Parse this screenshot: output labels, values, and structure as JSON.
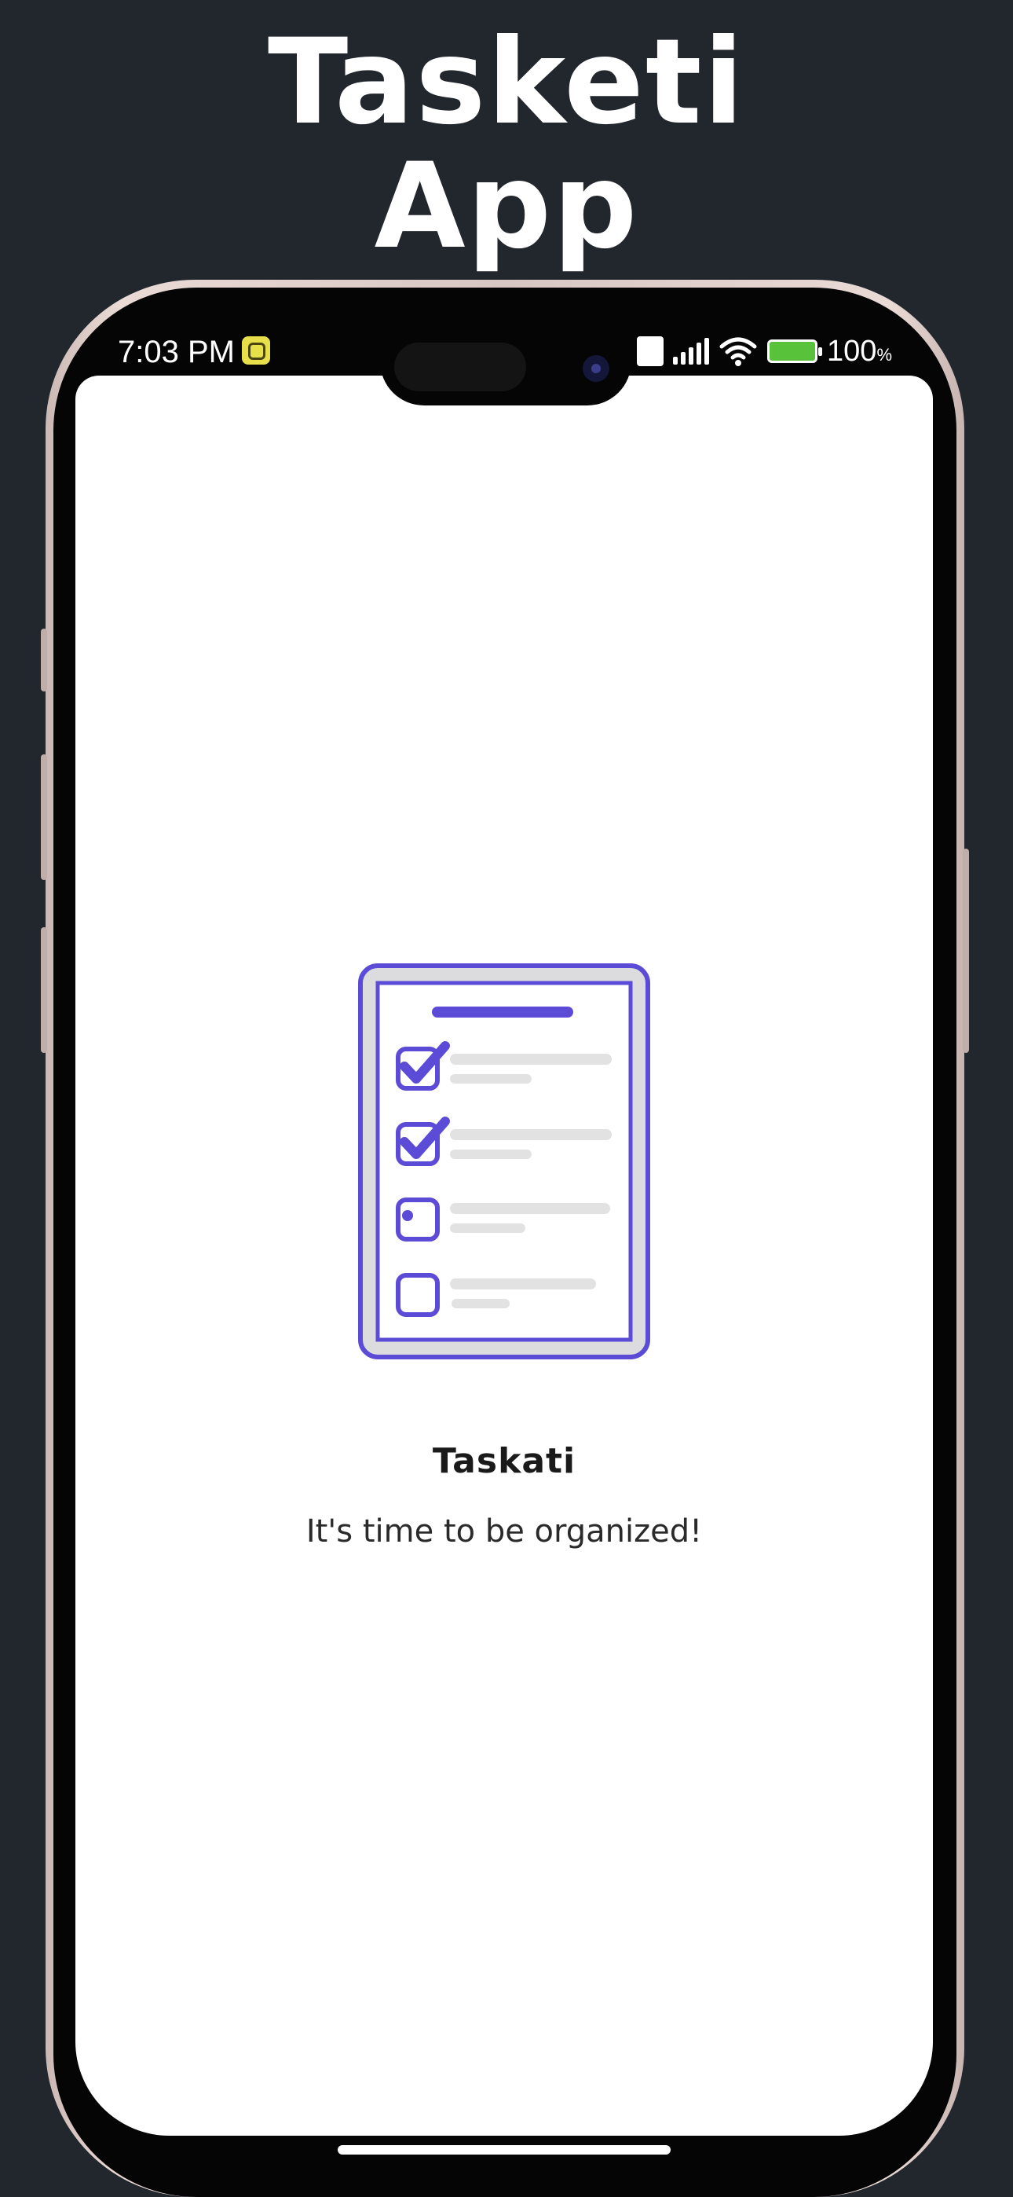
{
  "headline": {
    "line1": "Tasketi",
    "line2": "App"
  },
  "status_bar": {
    "time": "7:03 PM",
    "battery_value": "100",
    "battery_unit": "%",
    "icons": [
      "notification-icon",
      "volte-icon",
      "signal-icon",
      "wifi-icon",
      "battery-charging-icon"
    ]
  },
  "splash": {
    "title": "Taskati",
    "subtitle": "It's time to be organized!",
    "illustration": "checklist-clipboard-icon"
  },
  "colors": {
    "background": "#22262d",
    "accent": "#5b4bd6",
    "screen": "#ffffff"
  }
}
